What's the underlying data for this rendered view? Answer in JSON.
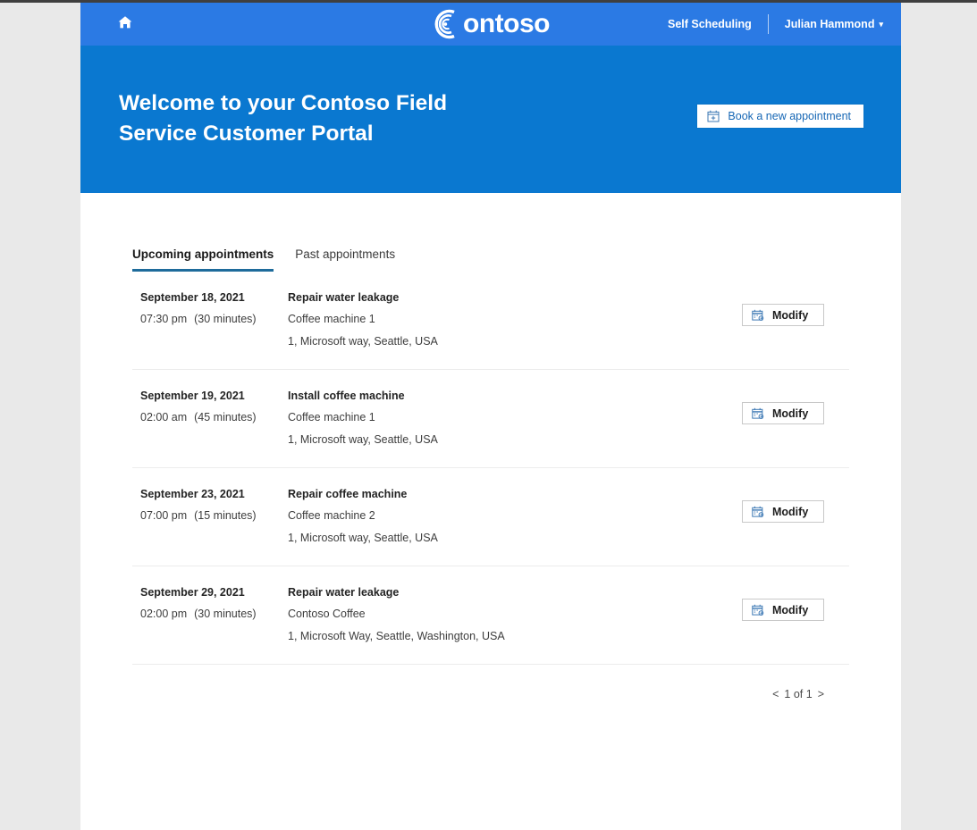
{
  "navbar": {
    "home_icon": "home-icon",
    "logo_text": "ontoso",
    "logo_full": "Contoso",
    "self_scheduling": "Self Scheduling",
    "user_name": "Julian Hammond",
    "caret": "▼",
    "bg_color": "#2b7ae4"
  },
  "hero": {
    "title_line1": "Welcome to your Contoso Field",
    "title_line2": "Service Customer Portal",
    "book_button": "Book a new appointment",
    "book_button_icon": "calendar-plus-icon",
    "bg_color": "#0a78d0"
  },
  "tabs": [
    {
      "label": "Upcoming appointments",
      "active": true
    },
    {
      "label": "Past appointments",
      "active": false
    }
  ],
  "tab_active_color": "#1e6b9b",
  "appointments": [
    {
      "date": "September 18, 2021",
      "time": "07:30 pm",
      "duration": "(30 minutes)",
      "subject": "Repair water leakage",
      "asset": "Coffee machine 1",
      "address": "1, Microsoft way, Seattle, USA",
      "action_label": "Modify",
      "action_icon": "calendar-edit-icon"
    },
    {
      "date": "September 19, 2021",
      "time": "02:00 am",
      "duration": "(45 minutes)",
      "subject": "Install coffee machine",
      "asset": "Coffee machine 1",
      "address": "1, Microsoft way, Seattle, USA",
      "action_label": "Modify",
      "action_icon": "calendar-edit-icon"
    },
    {
      "date": "September 23, 2021",
      "time": "07:00 pm",
      "duration": "(15 minutes)",
      "subject": "Repair coffee machine",
      "asset": "Coffee machine 2",
      "address": "1, Microsoft way, Seattle, USA",
      "action_label": "Modify",
      "action_icon": "calendar-edit-icon"
    },
    {
      "date": "September 29, 2021",
      "time": "02:00 pm",
      "duration": "(30 minutes)",
      "subject": "Repair water leakage",
      "asset": "Contoso Coffee",
      "address": "1, Microsoft Way, Seattle, Washington, USA",
      "action_label": "Modify",
      "action_icon": "calendar-edit-icon"
    }
  ],
  "pager": {
    "prev": "<",
    "text": "1 of 1",
    "next": ">"
  }
}
